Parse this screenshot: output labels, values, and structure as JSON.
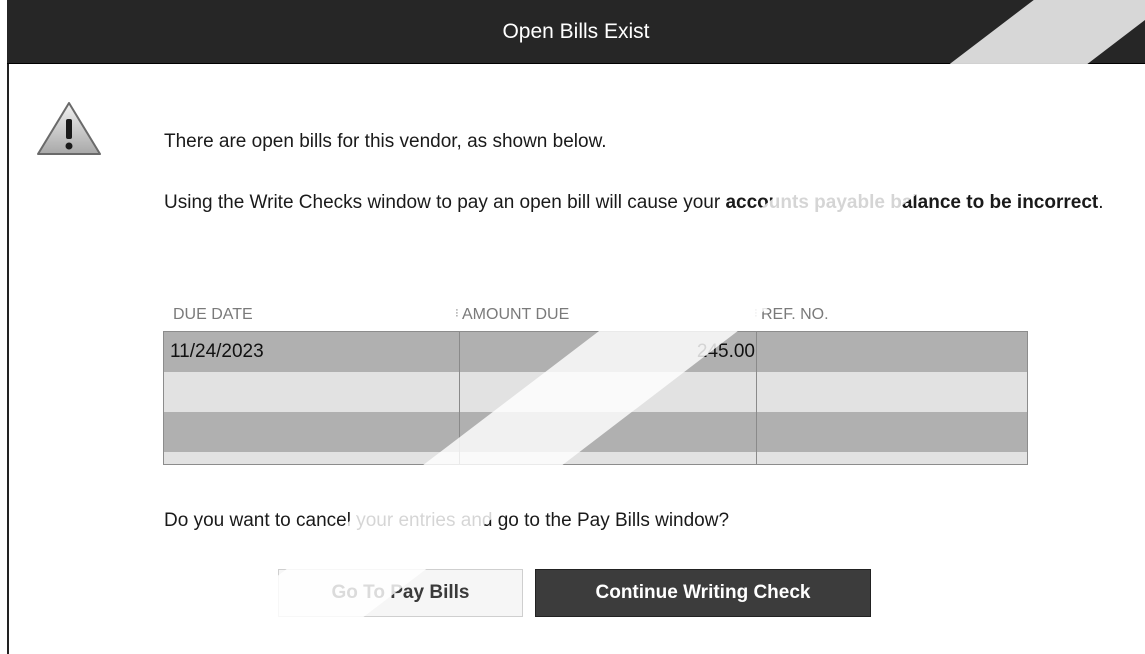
{
  "dialog": {
    "title": "Open Bills Exist",
    "message_line1": "There are open bills for this vendor, as shown below.",
    "message_line2_pre": "Using the Write Checks window to pay an open bill will cause your ",
    "message_line2_bold": "accounts payable balance to be incorrect",
    "message_line2_post": ".",
    "question": "Do you want to cancel your entries and go to the Pay Bills window?"
  },
  "table": {
    "headers": [
      "DUE DATE",
      "AMOUNT DUE",
      "REF. NO."
    ],
    "rows": [
      [
        "11/24/2023",
        "245.00",
        ""
      ],
      [
        "",
        "",
        ""
      ],
      [
        "",
        "",
        ""
      ]
    ]
  },
  "buttons": {
    "go_to_pay_bills": "Go To Pay Bills",
    "continue_writing_check": "Continue Writing Check"
  },
  "icons": {
    "warning": "warning-icon"
  },
  "colors": {
    "title_bar": "#262626",
    "row_dark": "#b0b0b0",
    "row_light": "#e2e2e2",
    "primary_button": "#3c3c3c"
  }
}
